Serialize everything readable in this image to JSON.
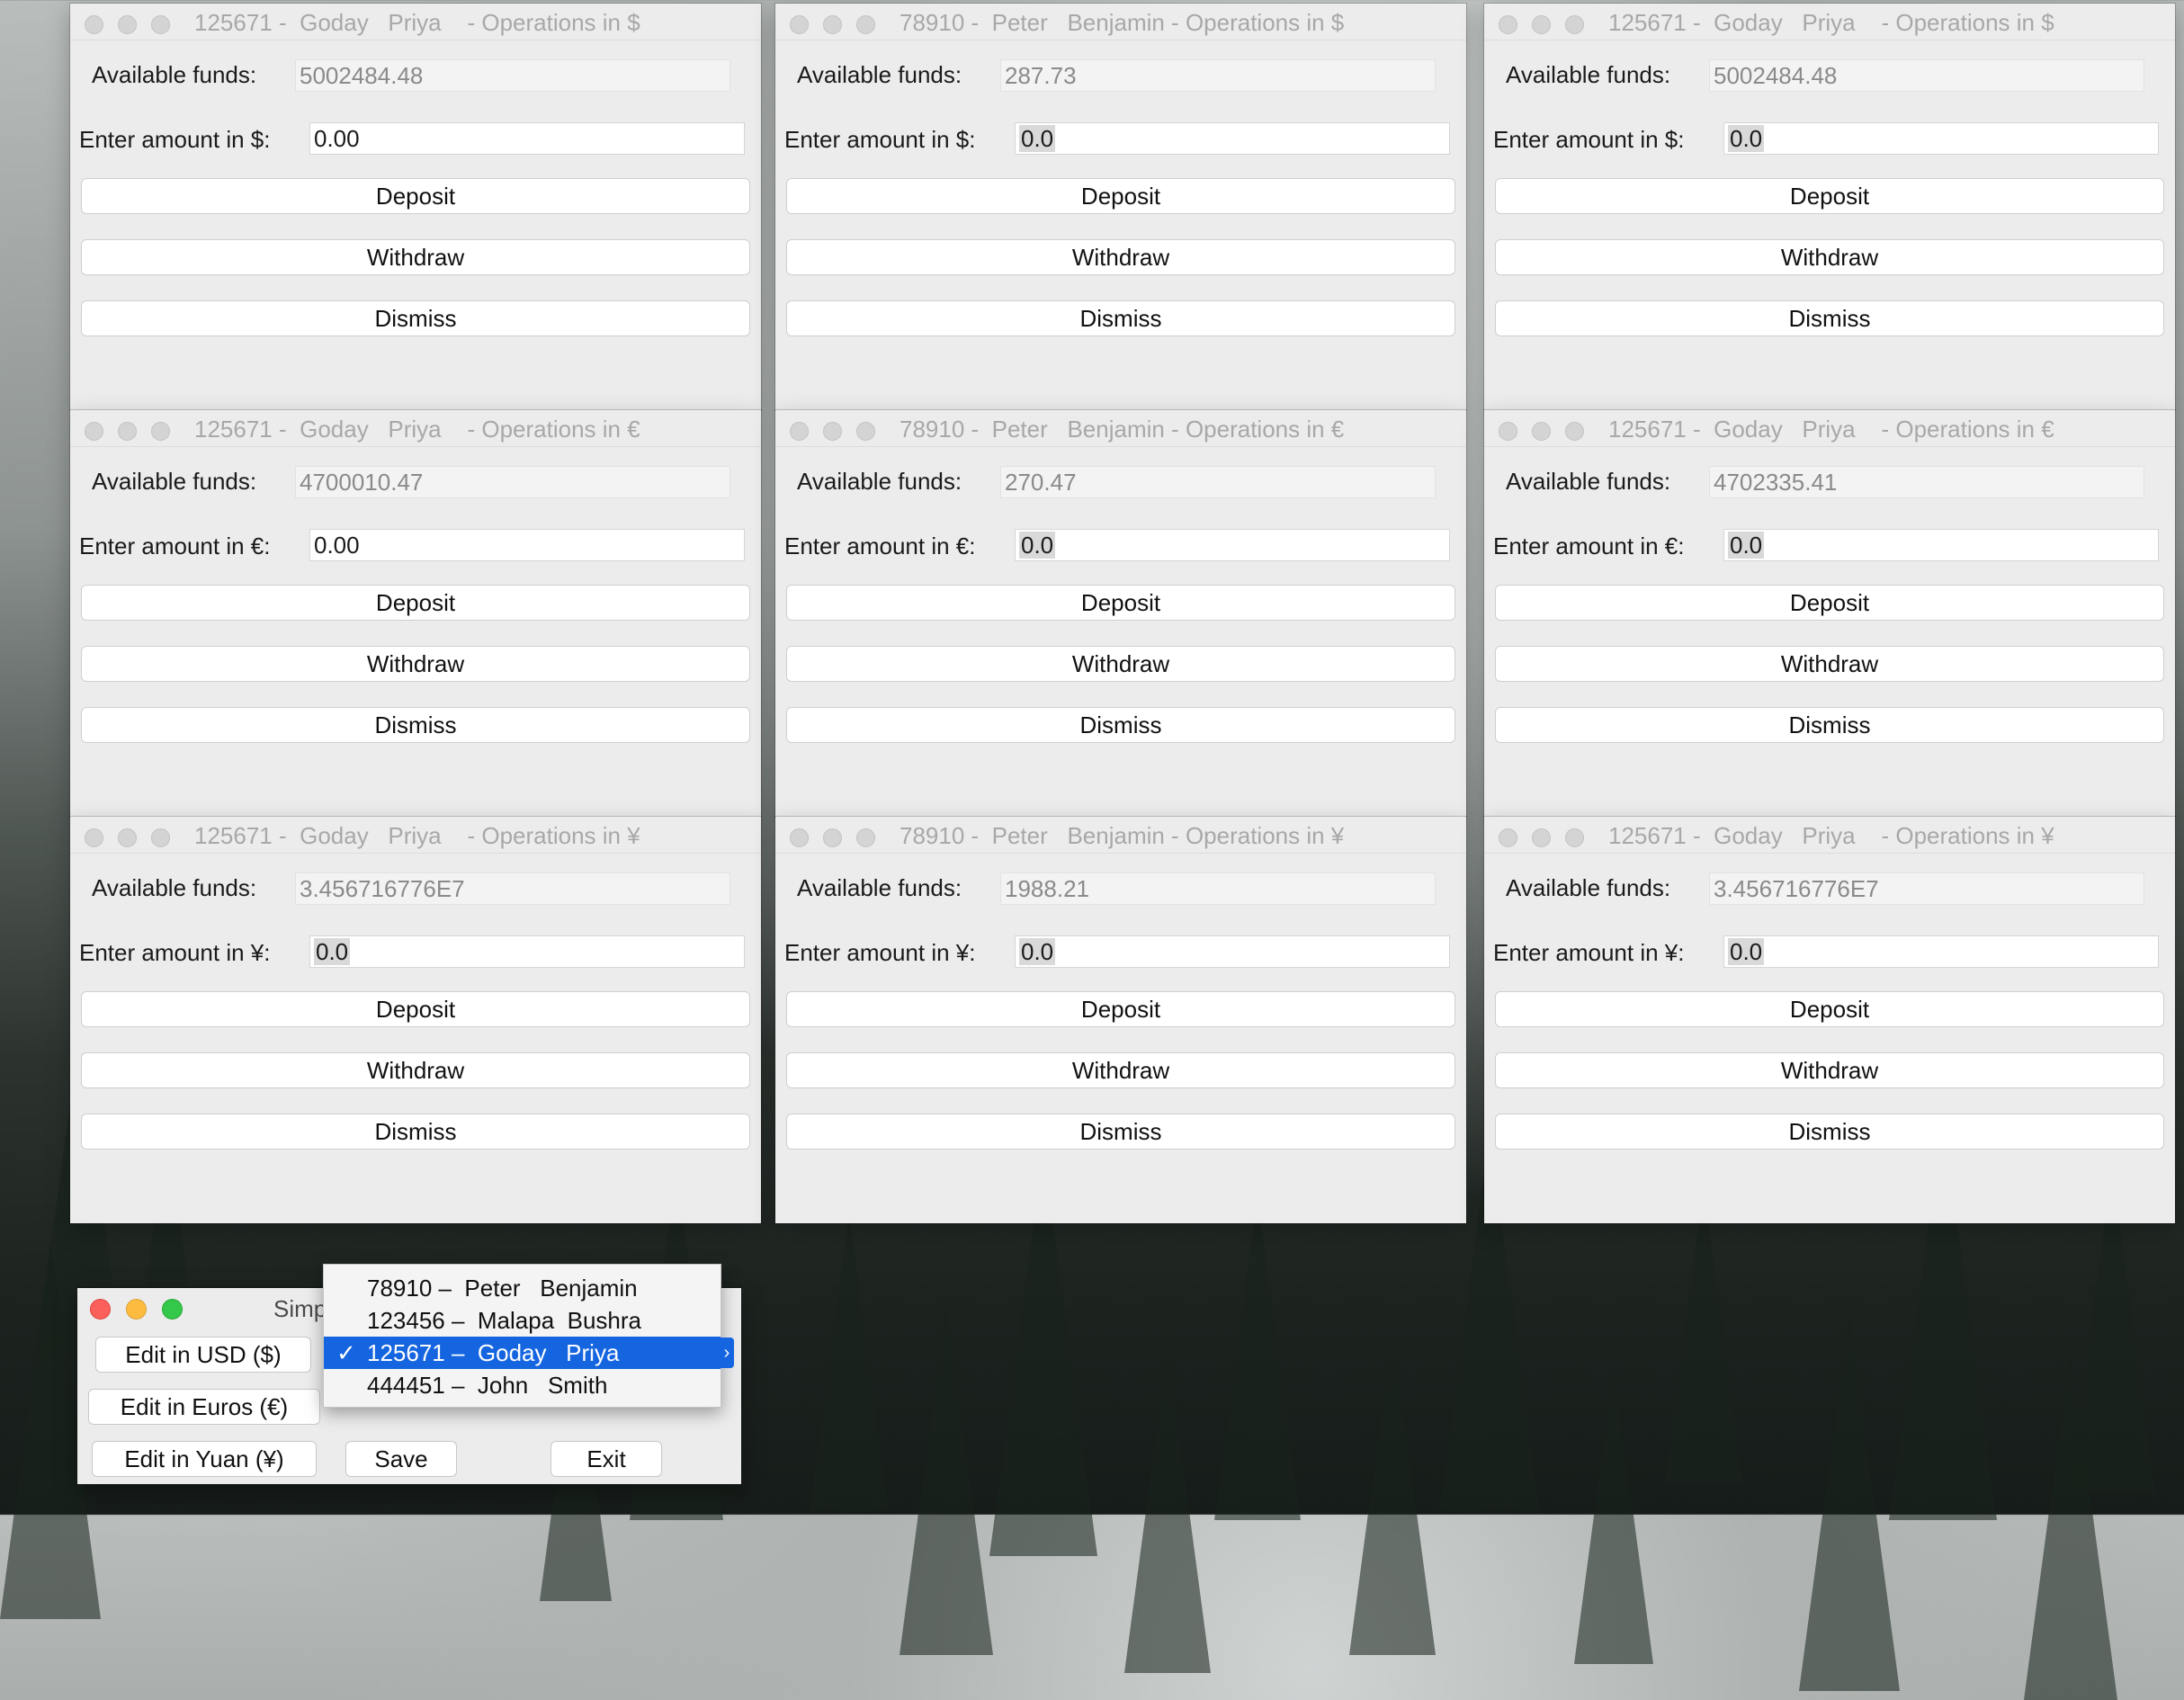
{
  "windows": [
    {
      "title": "125671 -  Goday   Priya    - Operations in $",
      "funds_label": "Available funds:",
      "funds": "5002484.48",
      "amount_label": "Enter amount in $:",
      "amount": "0.00",
      "amount_selected": false,
      "deposit": "Deposit",
      "withdraw": "Withdraw",
      "dismiss": "Dismiss"
    },
    {
      "title": "78910 -  Peter   Benjamin - Operations in $",
      "funds_label": "Available funds:",
      "funds": "287.73",
      "amount_label": "Enter amount in $:",
      "amount": "0.0",
      "amount_selected": true,
      "deposit": "Deposit",
      "withdraw": "Withdraw",
      "dismiss": "Dismiss"
    },
    {
      "title": "125671 -  Goday   Priya    - Operations in $",
      "funds_label": "Available funds:",
      "funds": "5002484.48",
      "amount_label": "Enter amount in $:",
      "amount": "0.0",
      "amount_selected": true,
      "deposit": "Deposit",
      "withdraw": "Withdraw",
      "dismiss": "Dismiss"
    },
    {
      "title": "125671 -  Goday   Priya    - Operations in €",
      "funds_label": "Available funds:",
      "funds": "4700010.47",
      "amount_label": "Enter amount in €:",
      "amount": "0.00",
      "amount_selected": false,
      "deposit": "Deposit",
      "withdraw": "Withdraw",
      "dismiss": "Dismiss"
    },
    {
      "title": "78910 -  Peter   Benjamin - Operations in €",
      "funds_label": "Available funds:",
      "funds": "270.47",
      "amount_label": "Enter amount in €:",
      "amount": "0.0",
      "amount_selected": true,
      "deposit": "Deposit",
      "withdraw": "Withdraw",
      "dismiss": "Dismiss"
    },
    {
      "title": "125671 -  Goday   Priya    - Operations in €",
      "funds_label": "Available funds:",
      "funds": "4702335.41",
      "amount_label": "Enter amount in €:",
      "amount": "0.0",
      "amount_selected": true,
      "deposit": "Deposit",
      "withdraw": "Withdraw",
      "dismiss": "Dismiss"
    },
    {
      "title": "125671 -  Goday   Priya    - Operations in ¥",
      "funds_label": "Available funds:",
      "funds": "3.456716776E7",
      "amount_label": "Enter amount in ¥:",
      "amount": "0.0",
      "amount_selected": true,
      "deposit": "Deposit",
      "withdraw": "Withdraw",
      "dismiss": "Dismiss"
    },
    {
      "title": "78910 -  Peter   Benjamin - Operations in ¥",
      "funds_label": "Available funds:",
      "funds": "1988.21",
      "amount_label": "Enter amount in ¥:",
      "amount": "0.0",
      "amount_selected": true,
      "deposit": "Deposit",
      "withdraw": "Withdraw",
      "dismiss": "Dismiss"
    },
    {
      "title": "125671 -  Goday   Priya    - Operations in ¥",
      "funds_label": "Available funds:",
      "funds": "3.456716776E7",
      "amount_label": "Enter amount in ¥:",
      "amount": "0.0",
      "amount_selected": true,
      "deposit": "Deposit",
      "withdraw": "Withdraw",
      "dismiss": "Dismiss"
    }
  ],
  "control": {
    "title": "Simp",
    "edit_usd": "Edit in USD ($)",
    "edit_euros": "Edit in Euros (€)",
    "edit_yuan": "Edit in Yuan (¥)",
    "save": "Save",
    "exit": "Exit",
    "lights": {
      "close": "#fc605c",
      "minimize": "#fdbc40",
      "zoom": "#34c84a"
    }
  },
  "account_dropdown": {
    "options": [
      {
        "label": "78910 –  Peter   Benjamin",
        "selected": false
      },
      {
        "label": "123456 –  Malapa  Bushra",
        "selected": false
      },
      {
        "label": "125671 –  Goday   Priya",
        "selected": true
      },
      {
        "label": "444451 –  John   Smith",
        "selected": false
      }
    ],
    "check_glyph": "✓",
    "highlight_color": "#1565e0"
  }
}
